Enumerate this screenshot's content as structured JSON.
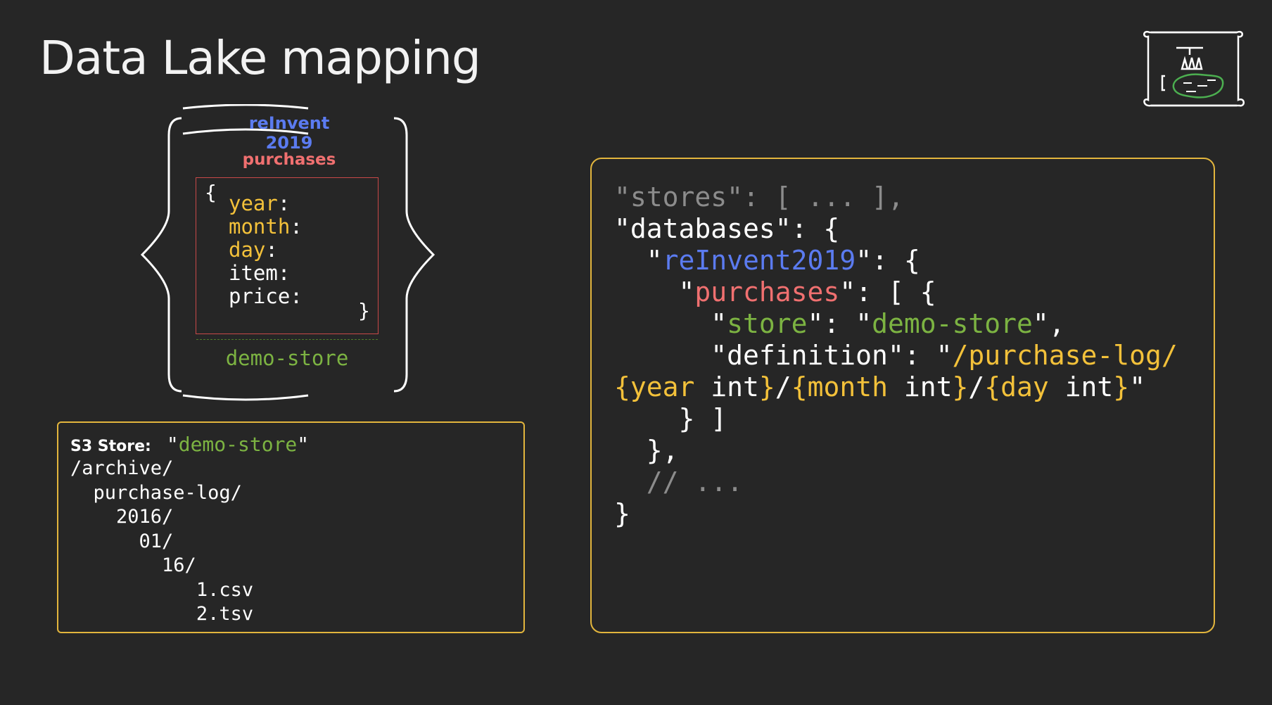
{
  "title": "Data Lake mapping",
  "diagram": {
    "database_label": "reInvent 2019",
    "table_label": "purchases",
    "open_brace": "{",
    "close_brace": "}",
    "fields": [
      {
        "name": "year",
        "colon": ":",
        "highlight": true
      },
      {
        "name": "month",
        "colon": ":",
        "highlight": true
      },
      {
        "name": "day",
        "colon": ":",
        "highlight": true
      },
      {
        "name": "item",
        "colon": ":",
        "highlight": false
      },
      {
        "name": "price",
        "colon": ":",
        "highlight": false
      }
    ],
    "store_label": "demo-store"
  },
  "s3": {
    "label": "S3 Store:",
    "quote": "\"",
    "name": "demo-store",
    "tree": [
      {
        "indent": "",
        "text": "/archive/"
      },
      {
        "indent": "  ",
        "text": "purchase-log/"
      },
      {
        "indent": "    ",
        "text": "2016/"
      },
      {
        "indent": "      ",
        "text": "01/"
      },
      {
        "indent": "        ",
        "text": "16/"
      },
      {
        "indent": "           ",
        "text": "1.csv"
      },
      {
        "indent": "           ",
        "text": "2.tsv"
      }
    ]
  },
  "json_code": {
    "l1": "\"stores\": [ ... ],",
    "l2": "\"databases\": {",
    "l3": {
      "indent": "  ",
      "q1": "\"",
      "key": "reInvent2019",
      "rest": "\": {"
    },
    "l4": {
      "indent": "    ",
      "q1": "\"",
      "key": "purchases",
      "rest": "\": [ {"
    },
    "l5": {
      "indent": "      ",
      "q1": "\"",
      "key": "store",
      "mid": "\": \"",
      "val": "demo-store",
      "rest": "\","
    },
    "l6": {
      "indent": "      ",
      "pre": "\"definition\": \"",
      "val": "/purchase-log/"
    },
    "l7": {
      "a": "{year",
      "b": " int",
      "c": "}",
      "d": "/",
      "e": "{month",
      "f": " int",
      "g": "}",
      "h": "/",
      "i": "{day",
      "j": " int",
      "k": "}",
      "l": "\""
    },
    "l8": "    } ]",
    "l9": "  },",
    "l10": "  // ...",
    "l11": "}"
  }
}
